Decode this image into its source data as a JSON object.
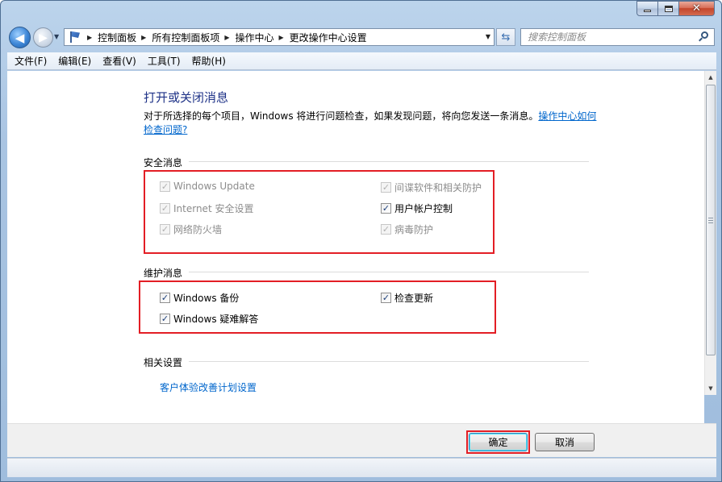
{
  "window": {
    "caption_buttons": {
      "minimize_icon": "minimize-icon",
      "maximize_icon": "maximize-icon",
      "close_icon": "close-icon"
    }
  },
  "nav": {
    "back_glyph": "◀",
    "forward_glyph": "▶",
    "address_icon": "control-panel-flag-icon",
    "breadcrumbs": [
      "控制面板",
      "所有控制面板项",
      "操作中心",
      "更改操作中心设置"
    ],
    "search_placeholder": "搜索控制面板"
  },
  "menu": {
    "items": [
      "文件(F)",
      "编辑(E)",
      "查看(V)",
      "工具(T)",
      "帮助(H)"
    ]
  },
  "main": {
    "title": "打开或关闭消息",
    "description": "对于所选择的每个项目，Windows 将进行问题检查，如果发现问题，将向您发送一条消息。",
    "help_link": "操作中心如何检查问题?"
  },
  "security": {
    "heading": "安全消息",
    "items": [
      {
        "label": "Windows Update",
        "checked": true,
        "enabled": false
      },
      {
        "label": "间谍软件和相关防护",
        "checked": true,
        "enabled": false
      },
      {
        "label": "Internet 安全设置",
        "checked": true,
        "enabled": false
      },
      {
        "label": "用户帐户控制",
        "checked": true,
        "enabled": true
      },
      {
        "label": "网络防火墙",
        "checked": true,
        "enabled": false
      },
      {
        "label": "病毒防护",
        "checked": true,
        "enabled": false
      }
    ]
  },
  "maintenance": {
    "heading": "维护消息",
    "items": [
      {
        "label": "Windows 备份",
        "checked": true,
        "enabled": true
      },
      {
        "label": "检查更新",
        "checked": true,
        "enabled": true
      },
      {
        "label": "Windows 疑难解答",
        "checked": true,
        "enabled": true
      }
    ]
  },
  "related": {
    "heading": "相关设置",
    "link": "客户体验改善计划设置"
  },
  "buttons": {
    "ok": "确定",
    "cancel": "取消"
  },
  "colors": {
    "highlight_red": "#e31e25",
    "title_blue": "#1e3287",
    "link_blue": "#0066cc"
  }
}
